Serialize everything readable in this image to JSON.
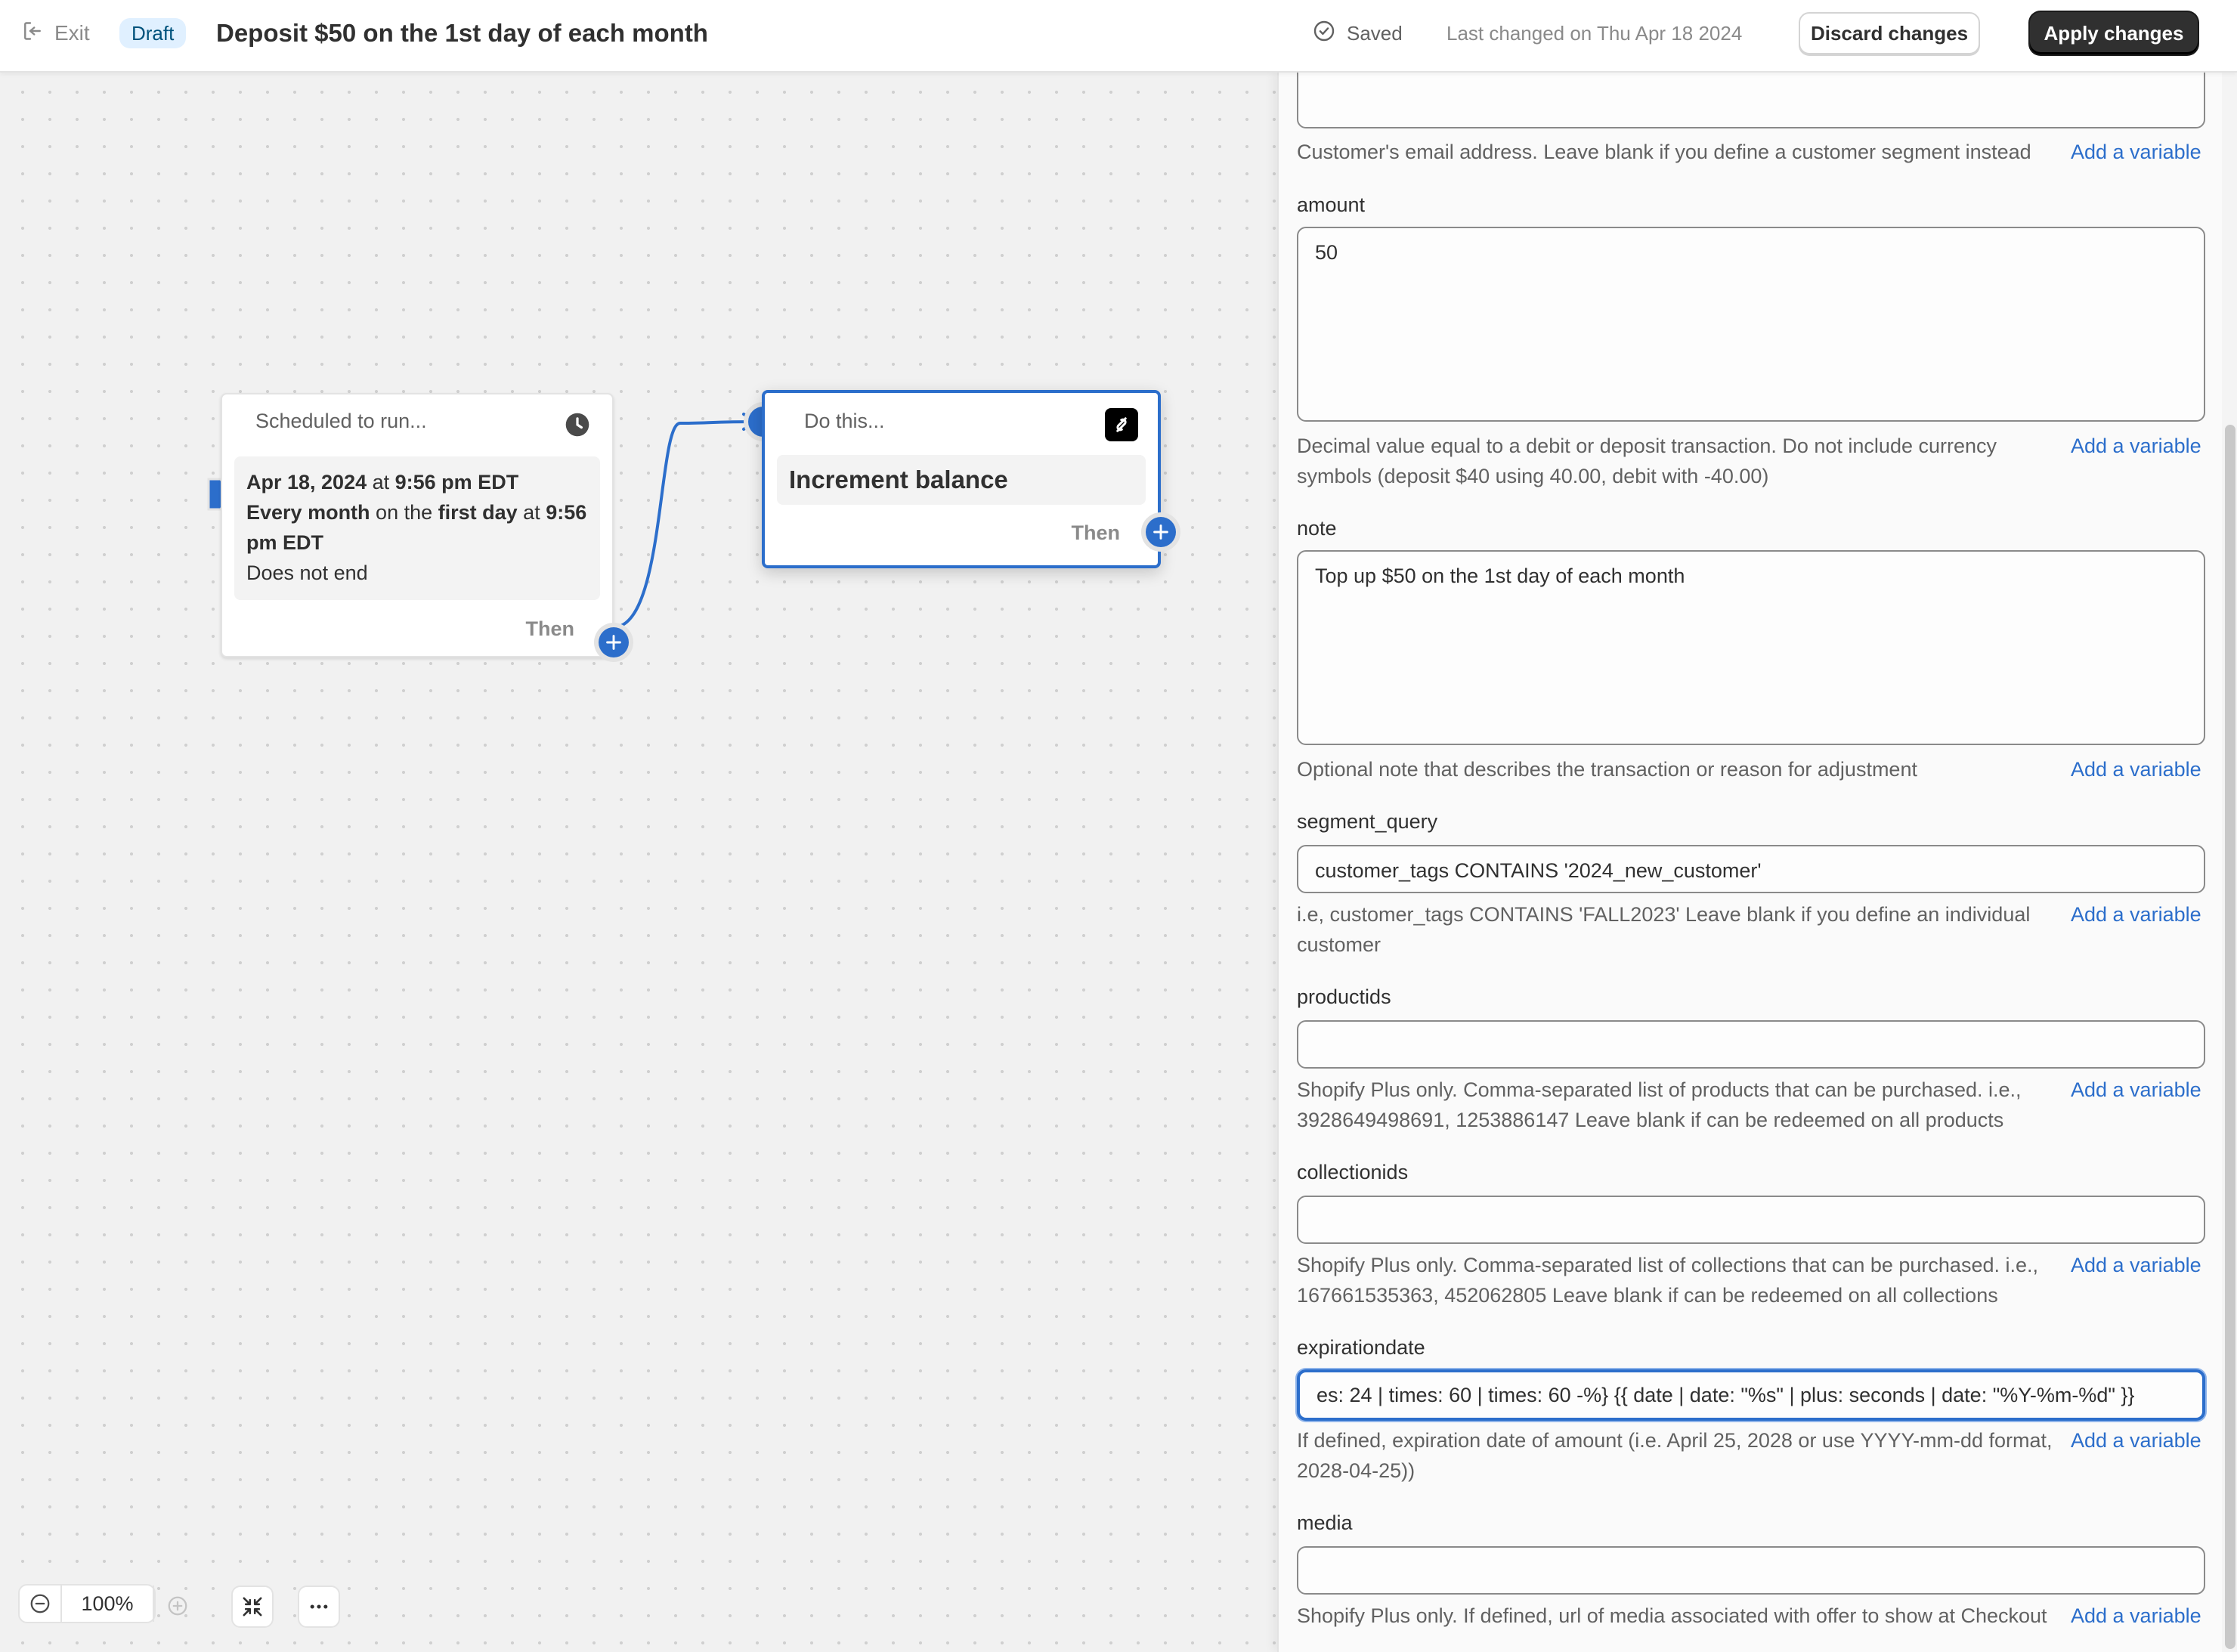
{
  "header": {
    "exit_label": "Exit",
    "status_badge": "Draft",
    "title": "Deposit $50 on the 1st day of each month",
    "saved_label": "Saved",
    "last_changed": "Last changed on Thu Apr 18 2024",
    "discard_label": "Discard changes",
    "apply_label": "Apply changes"
  },
  "canvas": {
    "trigger": {
      "heading": "Scheduled to run...",
      "line1_date": "Apr 18, 2024",
      "line1_at": " at ",
      "line1_time": "9:56 pm EDT",
      "line2_freq": "Every month",
      "line2_on": " on the ",
      "line2_day": "first day",
      "line2_at": " at ",
      "line2_time": "9:56 pm EDT",
      "line3": "Does not end",
      "then_label": "Then"
    },
    "action": {
      "heading": "Do this...",
      "name": "Increment balance",
      "then_label": "Then"
    },
    "zoom": {
      "value": "100%"
    }
  },
  "panel": {
    "email": {
      "value": "",
      "help": "Customer's email address. Leave blank if you define a customer segment instead",
      "add_variable": "Add a variable"
    },
    "amount": {
      "label": "amount",
      "value": "50",
      "help": "Decimal value equal to a debit or deposit transaction. Do not include currency symbols (deposit $40 using 40.00, debit with -40.00)",
      "add_variable": "Add a variable"
    },
    "note": {
      "label": "note",
      "value": "Top up $50 on the 1st day of each month",
      "help": "Optional note that describes the transaction or reason for adjustment",
      "add_variable": "Add a variable"
    },
    "segment_query": {
      "label": "segment_query",
      "value": "customer_tags CONTAINS '2024_new_customer'",
      "help": "i.e, customer_tags CONTAINS 'FALL2023' Leave blank if you define an individual customer",
      "add_variable": "Add a variable"
    },
    "productids": {
      "label": "productids",
      "value": "",
      "help": "Shopify Plus only. Comma-separated list of products that can be purchased. i.e., 3928649498691, 1253886147 Leave blank if can be redeemed on all products",
      "add_variable": "Add a variable"
    },
    "collectionids": {
      "label": "collectionids",
      "value": "",
      "help": "Shopify Plus only. Comma-separated list of collections that can be purchased. i.e., 167661535363, 452062805 Leave blank if can be redeemed on all collections",
      "add_variable": "Add a variable"
    },
    "expirationdate": {
      "label": "expirationdate",
      "value": "es: 24 | times: 60 | times: 60 -%} {{ date | date: \"%s\" | plus: seconds | date: \"%Y-%m-%d\" }}",
      "help": "If defined, expiration date of amount (i.e. April 25, 2028 or use YYYY-mm-dd format, 2028-04-25))",
      "add_variable": "Add a variable"
    },
    "media": {
      "label": "media",
      "value": "",
      "help": "Shopify Plus only. If defined, url of media associated with offer to show at Checkout",
      "add_variable": "Add a variable"
    }
  },
  "colors": {
    "accent": "#2c6ecb",
    "header_bg": "#ffffff",
    "canvas_bg": "#f1f1f1",
    "apply_bg": "#303030",
    "badge_bg": "#e0f0ff"
  }
}
